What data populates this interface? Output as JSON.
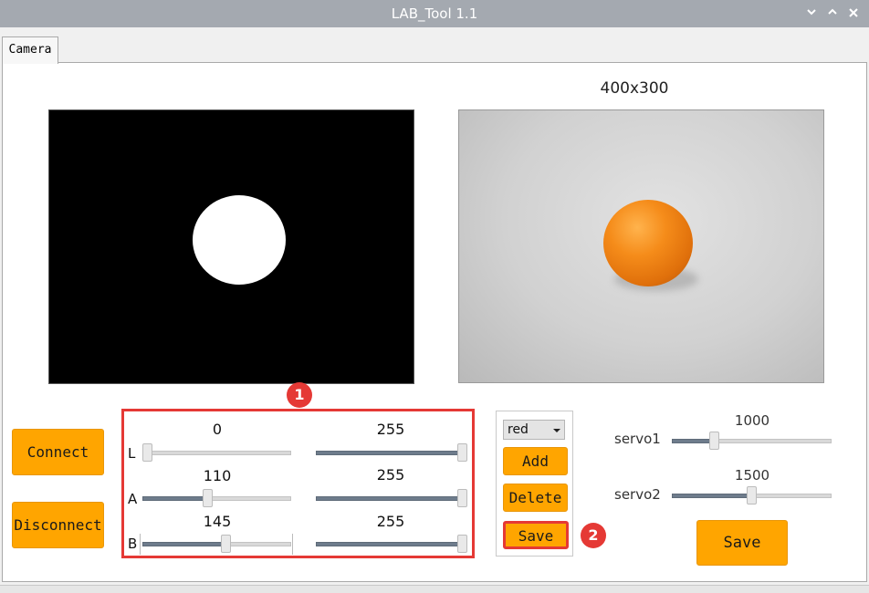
{
  "window": {
    "title": "LAB_Tool 1.1"
  },
  "tabs": [
    {
      "label": "Camera",
      "active": true
    }
  ],
  "camera": {
    "resolution": "400x300"
  },
  "buttons": {
    "connect": "Connect",
    "disconnect": "Disconnect",
    "add": "Add",
    "delete": "Delete",
    "save_color": "Save",
    "save_servo": "Save"
  },
  "lab_sliders": {
    "min": 0,
    "max": 255,
    "rows": [
      {
        "channel": "L",
        "low": "0",
        "high": "255",
        "low_value": 0,
        "high_value": 255
      },
      {
        "channel": "A",
        "low": "110",
        "high": "255",
        "low_value": 110,
        "high_value": 255
      },
      {
        "channel": "B",
        "low": "145",
        "high": "255",
        "low_value": 145,
        "high_value": 255
      }
    ]
  },
  "color_select": {
    "selected": "red"
  },
  "servos": {
    "min": 500,
    "max": 2500,
    "items": [
      {
        "label": "servo1",
        "value_text": "1000",
        "value": 1000
      },
      {
        "label": "servo2",
        "value_text": "1500",
        "value": 1500
      }
    ]
  },
  "annotations": {
    "badge_1": "1",
    "badge_2": "2"
  },
  "colors": {
    "button": "#ffa500",
    "highlight": "#e53935",
    "titlebar": "#a4a9b0",
    "ball": "#f58c1a"
  }
}
